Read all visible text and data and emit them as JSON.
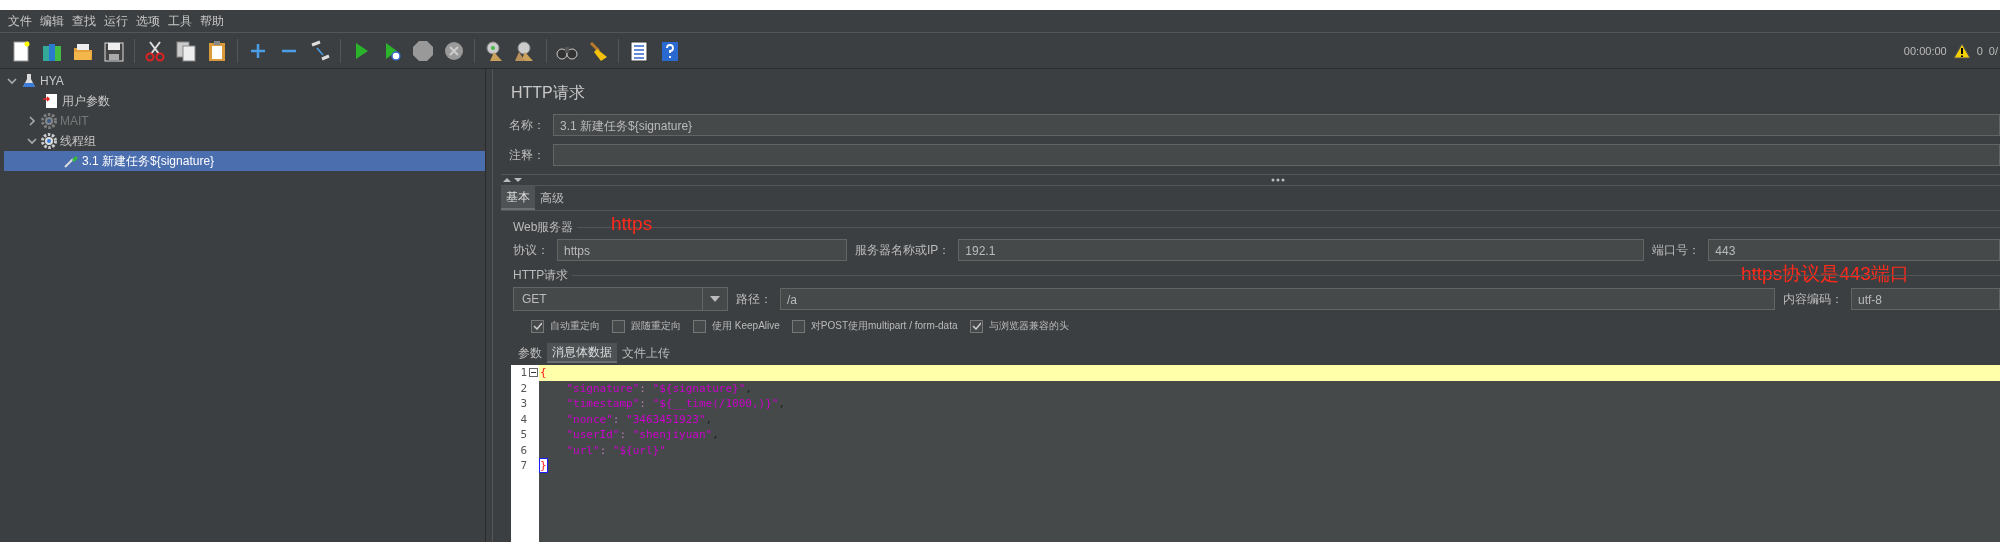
{
  "menu": [
    "文件",
    "编辑",
    "查找",
    "运行",
    "选项",
    "工具",
    "帮助"
  ],
  "status": {
    "time": "00:00:00",
    "warnings": "0",
    "threads": "0/"
  },
  "tree": [
    {
      "label": "HYA",
      "kind": "plan",
      "expanded": true,
      "disabled": false,
      "selected": false,
      "children": [
        {
          "label": "用户参数",
          "kind": "params",
          "disabled": false,
          "selected": false
        },
        {
          "label": "MAIT",
          "kind": "group",
          "expanded": false,
          "disabled": true,
          "selected": false
        },
        {
          "label": "线程组",
          "kind": "group",
          "expanded": true,
          "disabled": false,
          "selected": false,
          "children": [
            {
              "label": "3.1 新建任务${signature}",
              "kind": "sampler",
              "disabled": false,
              "selected": true
            }
          ]
        }
      ]
    }
  ],
  "panel": {
    "title": "HTTP请求",
    "name": {
      "label": "名称：",
      "value": "3.1 新建任务${signature}"
    },
    "comment": {
      "label": "注释："
    },
    "tabs": [
      {
        "label": "基本",
        "selected": true
      },
      {
        "label": "高级",
        "selected": false
      }
    ],
    "web_server": {
      "legend": "Web服务器",
      "annotation": "https",
      "protocol": {
        "label": "协议：",
        "value": "https"
      },
      "server": {
        "label": "服务器名称或IP：",
        "value": "192.1"
      },
      "port": {
        "label": "端口号：",
        "value": "443"
      },
      "port_annotation": "https协议是443端口"
    },
    "request": {
      "legend": "HTTP请求",
      "method": "GET",
      "path": {
        "label": "路径：",
        "value": "/a"
      },
      "encoding": {
        "label": "内容编码：",
        "value": "utf-8"
      },
      "options": [
        {
          "label": "自动重定向",
          "checked": true
        },
        {
          "label": "跟随重定向",
          "checked": false
        },
        {
          "label": "使用 KeepAlive",
          "checked": false
        },
        {
          "label": "对POST使用multipart / form-data",
          "checked": false
        },
        {
          "label": "与浏览器兼容的头",
          "checked": true
        }
      ]
    },
    "body_tabs": [
      {
        "label": "参数",
        "selected": false
      },
      {
        "label": "消息体数据",
        "selected": true
      },
      {
        "label": "文件上传",
        "selected": false
      }
    ],
    "editor": {
      "lines": [
        {
          "number": "1",
          "text": "{",
          "highlighted": true,
          "foldable": true
        },
        {
          "number": "2",
          "text": "    \"signature\": \"${signature}\",",
          "highlighted": false,
          "foldable": false
        },
        {
          "number": "3",
          "text": "    \"timestamp\": \"${__time(/1000,)}\",",
          "highlighted": false,
          "foldable": false
        },
        {
          "number": "4",
          "text": "    \"nonce\": \"3463451923\",",
          "highlighted": false,
          "foldable": false
        },
        {
          "number": "5",
          "text": "    \"userId\": \"shenjiyuan\",",
          "highlighted": false,
          "foldable": false
        },
        {
          "number": "6",
          "text": "    \"url\": \"${url}\"",
          "highlighted": false,
          "foldable": false
        },
        {
          "number": "7",
          "text": "}",
          "highlighted": false,
          "foldable": false,
          "bracket_match": true
        }
      ]
    }
  }
}
